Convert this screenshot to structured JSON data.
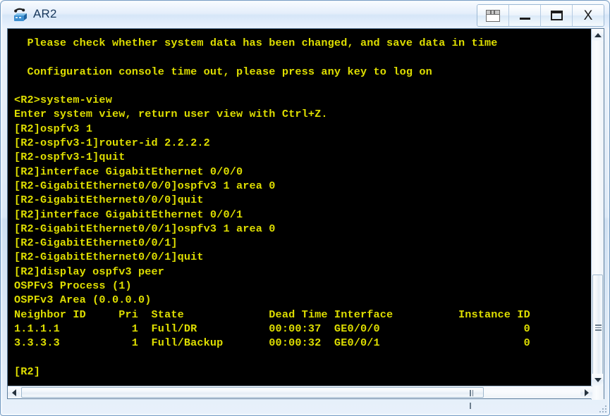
{
  "window": {
    "title": "AR2",
    "icon": "router-device-icon",
    "buttons": [
      {
        "name": "layout-restore-button",
        "label": ""
      },
      {
        "name": "minimize-button",
        "label": ""
      },
      {
        "name": "maximize-button",
        "label": ""
      },
      {
        "name": "close-button",
        "label": "X"
      }
    ]
  },
  "terminal": {
    "fg_color": "#dede00",
    "bg_color": "#000000",
    "lines": [
      "  Please check whether system data has been changed, and save data in time",
      "",
      "  Configuration console time out, please press any key to log on",
      "",
      "<R2>system-view",
      "Enter system view, return user view with Ctrl+Z.",
      "[R2]ospfv3 1",
      "[R2-ospfv3-1]router-id 2.2.2.2",
      "[R2-ospfv3-1]quit",
      "[R2]interface GigabitEthernet 0/0/0",
      "[R2-GigabitEthernet0/0/0]ospfv3 1 area 0",
      "[R2-GigabitEthernet0/0/0]quit",
      "[R2]interface GigabitEthernet 0/0/1",
      "[R2-GigabitEthernet0/0/1]ospfv3 1 area 0",
      "[R2-GigabitEthernet0/0/1]",
      "[R2-GigabitEthernet0/0/1]quit",
      "[R2]display ospfv3 peer",
      "OSPFv3 Process (1)",
      "OSPFv3 Area (0.0.0.0)",
      "Neighbor ID     Pri  State             Dead Time Interface          Instance ID",
      "1.1.1.1           1  Full/DR           00:00:37  GE0/0/0                      0",
      "3.3.3.3           1  Full/Backup       00:00:32  GE0/0/1                      0",
      "",
      "[R2]"
    ],
    "peer_table": {
      "headers": [
        "Neighbor ID",
        "Pri",
        "State",
        "Dead Time",
        "Interface",
        "Instance ID"
      ],
      "rows": [
        [
          "1.1.1.1",
          "1",
          "Full/DR",
          "00:00:37",
          "GE0/0/0",
          "0"
        ],
        [
          "3.3.3.3",
          "1",
          "Full/Backup",
          "00:00:32",
          "GE0/0/1",
          "0"
        ]
      ],
      "process": "OSPFv3 Process (1)",
      "area": "OSPFv3 Area (0.0.0.0)"
    },
    "prompt": "[R2]"
  },
  "scrollbars": {
    "vertical": {
      "up_arrow": "▲",
      "down_arrow": "▼"
    },
    "horizontal": {
      "left_arrow": "◀",
      "right_arrow": "▶"
    }
  }
}
